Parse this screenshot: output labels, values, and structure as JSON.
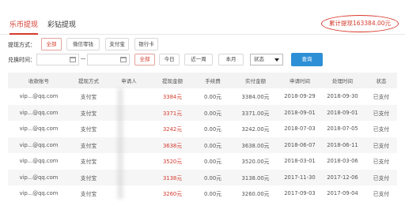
{
  "tabs": [
    {
      "label": "乐币提现"
    },
    {
      "label": "彩钻提现"
    }
  ],
  "total": {
    "text": "累计提现163384.00元"
  },
  "filters": {
    "method_label": "提现方式：",
    "methods": [
      {
        "label": "全部"
      },
      {
        "label": "微信零钱"
      },
      {
        "label": "支付宝"
      },
      {
        "label": "银行卡"
      }
    ],
    "time_label": "兑换时间：",
    "start_date": "",
    "end_date": "",
    "range_buttons": [
      {
        "label": "全部"
      },
      {
        "label": "今日"
      },
      {
        "label": "近一周"
      },
      {
        "label": "本月"
      }
    ],
    "status_select": "状态",
    "query_label": "查询"
  },
  "table": {
    "columns": [
      "收款账号",
      "提现方式",
      "申请人",
      "提现金额",
      "手续费",
      "实付金额",
      "申请时间",
      "处理时间",
      "状态"
    ],
    "rows": [
      [
        "vip...@qq.com",
        "支付宝",
        "",
        "3384元",
        "0.00元",
        "3384.00元",
        "2018-09-29",
        "2018-09-30",
        "已支付"
      ],
      [
        "vip...@qq.com",
        "支付宝",
        "",
        "3371元",
        "0.00元",
        "3371.00元",
        "2018-09-01",
        "2018-09-01",
        "已支付"
      ],
      [
        "vip...@qq.com",
        "支付宝",
        "",
        "3242元",
        "0.00元",
        "3242.00元",
        "2018-07-03",
        "2018-07-05",
        "已支付"
      ],
      [
        "vip...@qq.com",
        "支付宝",
        "",
        "3638元",
        "0.00元",
        "3638.00元",
        "2018-06-07",
        "2018-06-11",
        "已支付"
      ],
      [
        "vip...@qq.com",
        "支付宝",
        "",
        "3520元",
        "0.00元",
        "3520.00元",
        "2018-03-01",
        "2018-03-06",
        "已支付"
      ],
      [
        "vip...@qq.com",
        "支付宝",
        "",
        "3138元",
        "0.00元",
        "3138.00元",
        "2017-11-30",
        "2017-12-06",
        "已支付"
      ],
      [
        "vip...@qq.com",
        "支付宝",
        "",
        "3260元",
        "0.00元",
        "3260.00元",
        "2017-09-03",
        "2017-09-04",
        "已支付"
      ]
    ]
  }
}
